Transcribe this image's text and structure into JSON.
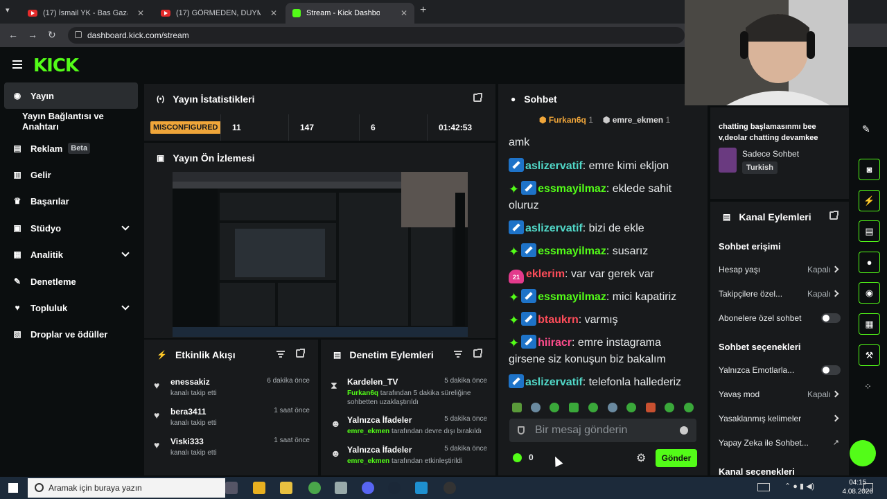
{
  "browser": {
    "tabs": [
      {
        "title": "(17) İsmail YK - Bas Gaza (Offici",
        "icon": "youtube-icon"
      },
      {
        "title": "(17) GÖRMEDEN, DUYMADAN",
        "icon": "youtube-icon"
      },
      {
        "title": "Stream - Kick Dashboard",
        "icon": "kick-icon"
      }
    ],
    "url": "dashboard.kick.com/stream"
  },
  "logo": "KICK",
  "sidebar": {
    "items": [
      {
        "label": "Yayın",
        "icon": "broadcast-icon"
      },
      {
        "label": "Yayın Bağlantısı ve Anahtarı"
      },
      {
        "label": "Reklam",
        "badge": "Beta",
        "icon": "ad-icon"
      },
      {
        "label": "Gelir",
        "icon": "chart-icon"
      },
      {
        "label": "Başarılar",
        "icon": "trophy-icon"
      },
      {
        "label": "Stüdyo",
        "icon": "studio-icon"
      },
      {
        "label": "Analitik",
        "icon": "analytics-icon"
      },
      {
        "label": "Denetleme",
        "icon": "wrench-icon"
      },
      {
        "label": "Topluluk",
        "icon": "community-icon"
      },
      {
        "label": "Droplar ve ödüller",
        "icon": "drops-icon"
      }
    ]
  },
  "stats": {
    "title": "Yayın İstatistikleri",
    "status": "MISCONFIGURED",
    "values": [
      "11",
      "147",
      "6",
      "01:42:53"
    ]
  },
  "preview": {
    "title": "Yayın Ön İzlemesi"
  },
  "activity": {
    "title": "Etkinlik Akışı",
    "items": [
      {
        "name": "enessakiz",
        "sub": "kanalı takip etti",
        "time": "6 dakika önce"
      },
      {
        "name": "bera3411",
        "sub": "kanalı takip etti",
        "time": "1 saat önce"
      },
      {
        "name": "Viski333",
        "sub": "kanalı takip etti",
        "time": "1 saat önce"
      }
    ]
  },
  "moderation": {
    "title": "Denetim Eylemleri",
    "items": [
      {
        "name": "Kardelen_TV",
        "actor": "Furkan6q",
        "sub": "tarafından 5 dakika süreliğine sohbetten uzaklaştırıldı",
        "time": "5 dakika önce"
      },
      {
        "name": "Yalnızca İfadeler",
        "actor": "emre_ekmen",
        "sub": "tarafından devre dışı bırakıldı",
        "time": "5 dakika önce"
      },
      {
        "name": "Yalnızca İfadeler",
        "actor": "emre_ekmen",
        "sub": "tarafından etkinleştirildi",
        "time": "5 dakika önce"
      }
    ]
  },
  "chat": {
    "title": "Sohbet",
    "pinned_users": [
      {
        "name": "Furkan6q",
        "count": "1"
      },
      {
        "name": "emre_ekmen",
        "count": "1"
      }
    ],
    "messages": [
      {
        "text": "amk"
      },
      {
        "user": "aslizervatif",
        "text": "emre kimi ekljon"
      },
      {
        "user": "essmayilmaz",
        "text": "eklede sahit oluruz"
      },
      {
        "user": "aslizervatif",
        "text": "bizi de ekle"
      },
      {
        "user": "essmayilmaz",
        "text": "susarız"
      },
      {
        "user": "eklerim",
        "sub_badge": "21",
        "text": "var var gerek var"
      },
      {
        "user": "essmayilmaz",
        "text": "mici kapatiriz"
      },
      {
        "user": "btaukrn",
        "text": "varmış"
      },
      {
        "user": "hiiracr",
        "text": "emre instagrama girsene siz konuşun biz bakalım"
      },
      {
        "user": "aslizervatif",
        "text": "telefonla hallederiz"
      }
    ],
    "input_placeholder": "Bir mesaj gönderin",
    "points": "0",
    "send_label": "Gönder"
  },
  "stream_info": {
    "title": "chatting başlamasınmı bee v,deolar chatting devamkee",
    "category": "Sadece Sohbet",
    "language": "Turkish"
  },
  "channel_actions": {
    "title": "Kanal Eylemleri",
    "chat_access": "Sohbet erişimi",
    "rows_access": [
      {
        "label": "Hesap yaşı",
        "value": "Kapalı"
      },
      {
        "label": "Takipçilere özel...",
        "value": "Kapalı"
      },
      {
        "label": "Abonelere özel sohbet"
      }
    ],
    "chat_options": "Sohbet seçenekleri",
    "rows_options": [
      {
        "label": "Yalnızca Emotlarla..."
      },
      {
        "label": "Yavaş mod",
        "value": "Kapalı"
      },
      {
        "label": "Yasaklanmış kelimeler"
      },
      {
        "label": "Yapay Zeka ile Sohbet..."
      }
    ],
    "cut_label": "Kanal seçenekleri"
  },
  "taskbar": {
    "search_placeholder": "Aramak için buraya yazın",
    "time": "04:15",
    "date": "4.08.2026"
  }
}
